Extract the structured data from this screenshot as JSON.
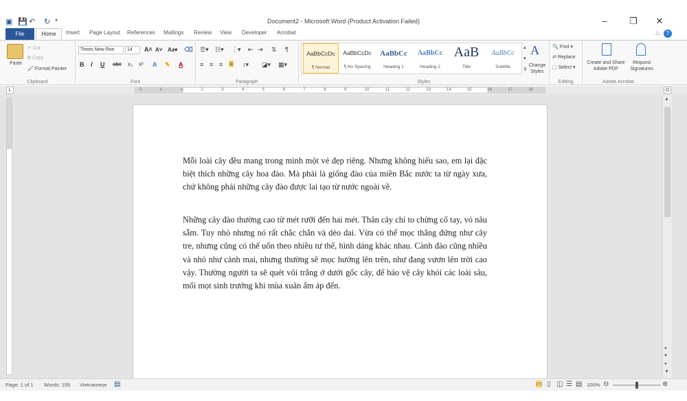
{
  "titlebar": {
    "title": "Document2 - Microsoft Word (Product Activation Failed)",
    "quick_access": [
      "save-icon",
      "undo-icon",
      "redo-icon"
    ],
    "window_controls": [
      "minimize-icon",
      "restore-icon",
      "close-icon"
    ]
  },
  "tabs": [
    "File",
    "Home",
    "Insert",
    "Page Layout",
    "References",
    "Mailings",
    "Review",
    "View",
    "Developer",
    "Acrobat"
  ],
  "clipboard": {
    "paste": "Paste",
    "cut": "Cut",
    "copy": "Copy",
    "format_painter": "Format Painter",
    "label": "Clipboard"
  },
  "font": {
    "name": "Times New Ron",
    "size": "14",
    "label": "Font"
  },
  "paragraph": {
    "label": "Paragraph"
  },
  "styles": {
    "label": "Styles",
    "items": [
      {
        "preview": "AaBbCcDc",
        "name": "¶ Normal"
      },
      {
        "preview": "AaBbCcDc",
        "name": "¶ No Spacing"
      },
      {
        "preview": "AaBbCc",
        "name": "Heading 1"
      },
      {
        "preview": "AaBbCc",
        "name": "Heading 2"
      },
      {
        "preview": "AaB",
        "name": "Title"
      },
      {
        "preview": "AaBbCc",
        "name": "Subtitle"
      }
    ],
    "change_styles": "Change Styles"
  },
  "editing": {
    "find": "Find",
    "replace": "Replace",
    "select": "Select",
    "label": "Editing"
  },
  "acrobat": {
    "create_share": "Create and Share Adobe PDF",
    "request_signatures": "Request Signatures",
    "label": "Adobe Acrobat"
  },
  "ruler": {
    "ticks": [
      "2",
      "1",
      "1",
      "2",
      "3",
      "4",
      "5",
      "6",
      "7",
      "8",
      "9",
      "10",
      "11",
      "12",
      "13",
      "14",
      "15",
      "16",
      "17",
      "18"
    ]
  },
  "document": {
    "paragraphs": [
      "Mỗi loài cây đều mang trong mình một vẻ đẹp riêng. Nhưng không hiểu sao, em lại đặc biệt thích những cây hoa đào. Mà phải là giống đào của miền Bắc nước ta từ ngày xưa, chứ không phải những cây đào được lai tạo từ nước ngoài về.",
      "Những cây đào thường cao từ mét rưỡi đến hai mét. Thân cây chỉ to chừng cổ tay, vỏ nâu sẫm. Tuy nhỏ nhưng nó rất chắc chắn và dẻo dai. Vừa có thể mọc thẳng đứng như cây tre, nhưng cũng có thể uốn theo nhiều tư thế, hình dáng khác nhau. Cành đào cũng nhiều và nhỏ như cành mai, nhưng thường sẽ mọc hướng lên trên, như đang vươn lên trời cao vậy. Thường người ta sẽ quét vôi trắng ở dưới gốc cây, để bảo vệ cây khỏi các loài sâu, mối mọt sinh trưởng khi mùa xuân ấm áp đến."
    ]
  },
  "status": {
    "page": "Page: 1 of 1",
    "words": "Words: 155",
    "language": "Vietnamese",
    "zoom": "100%"
  }
}
